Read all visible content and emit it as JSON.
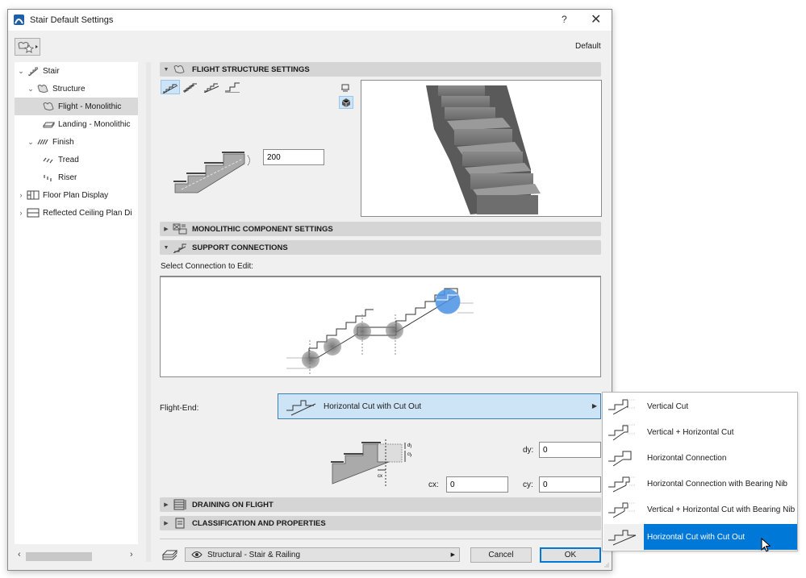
{
  "window": {
    "title": "Stair Default Settings",
    "help_label": "?",
    "close_label": "✕",
    "default_label": "Default"
  },
  "tree": {
    "items": [
      {
        "label": "Stair",
        "level": 0,
        "expanded": true,
        "icon": "stair-icon"
      },
      {
        "label": "Structure",
        "level": 1,
        "expanded": true,
        "icon": "structure-icon"
      },
      {
        "label": "Flight - Monolithic",
        "level": 2,
        "selected": true,
        "icon": "flight-icon"
      },
      {
        "label": "Landing - Monolithic",
        "level": 2,
        "icon": "landing-icon"
      },
      {
        "label": "Finish",
        "level": 1,
        "expanded": true,
        "icon": "finish-icon"
      },
      {
        "label": "Tread",
        "level": 2,
        "icon": "tread-icon"
      },
      {
        "label": "Riser",
        "level": 2,
        "icon": "riser-icon"
      },
      {
        "label": "Floor Plan Display",
        "level": 0,
        "expanded": false,
        "icon": "floor-plan-icon"
      },
      {
        "label": "Reflected Ceiling Plan Di",
        "level": 0,
        "expanded": false,
        "icon": "ceiling-plan-icon"
      }
    ],
    "scroll_left": "‹",
    "scroll_right": "›"
  },
  "panels": {
    "flight_structure": {
      "label": "FLIGHT STRUCTURE SETTINGS",
      "expanded": true
    },
    "monolithic_component": {
      "label": "MONOLITHIC COMPONENT SETTINGS",
      "expanded": false
    },
    "support_connections": {
      "label": "SUPPORT CONNECTIONS",
      "expanded": true
    },
    "draining": {
      "label": "DRAINING ON FLIGHT",
      "expanded": false
    },
    "classification": {
      "label": "CLASSIFICATION AND PROPERTIES",
      "expanded": false
    }
  },
  "flight": {
    "thickness_value": "200",
    "structure_types": [
      "sloped",
      "stepped",
      "sloped-stepped",
      "cantilevered"
    ],
    "selected_type_index": 0,
    "view_modes": [
      "plan-view",
      "3d-view"
    ],
    "selected_view": "3d-view"
  },
  "support": {
    "select_label": "Select Connection to Edit:",
    "flight_end_label": "Flight-End:",
    "flight_end_value": "Horizontal Cut with Cut Out",
    "dy_label": "dy:",
    "dy_value": "0",
    "cx_label": "cx:",
    "cx_value": "0",
    "cy_label": "cy:",
    "cy_value": "0",
    "diagram_labels": {
      "dy": "dy",
      "cy": "cy",
      "cx": "cx"
    }
  },
  "connection_menu": {
    "items": [
      {
        "label": "Vertical Cut"
      },
      {
        "label": "Vertical + Horizontal Cut"
      },
      {
        "label": "Horizontal Connection"
      },
      {
        "label": "Horizontal Connection with Bearing Nib"
      },
      {
        "label": "Vertical + Horizontal Cut with Bearing Nib"
      },
      {
        "label": "Horizontal Cut with Cut Out",
        "selected": true
      }
    ]
  },
  "footer": {
    "layer_value": "Structural - Stair & Railing",
    "cancel_label": "Cancel",
    "ok_label": "OK"
  },
  "colors": {
    "accent": "#0078d7",
    "selection_light": "#cce4f7",
    "panel_header": "#d5d5d5",
    "dialog_bg": "#f0f0f0"
  }
}
